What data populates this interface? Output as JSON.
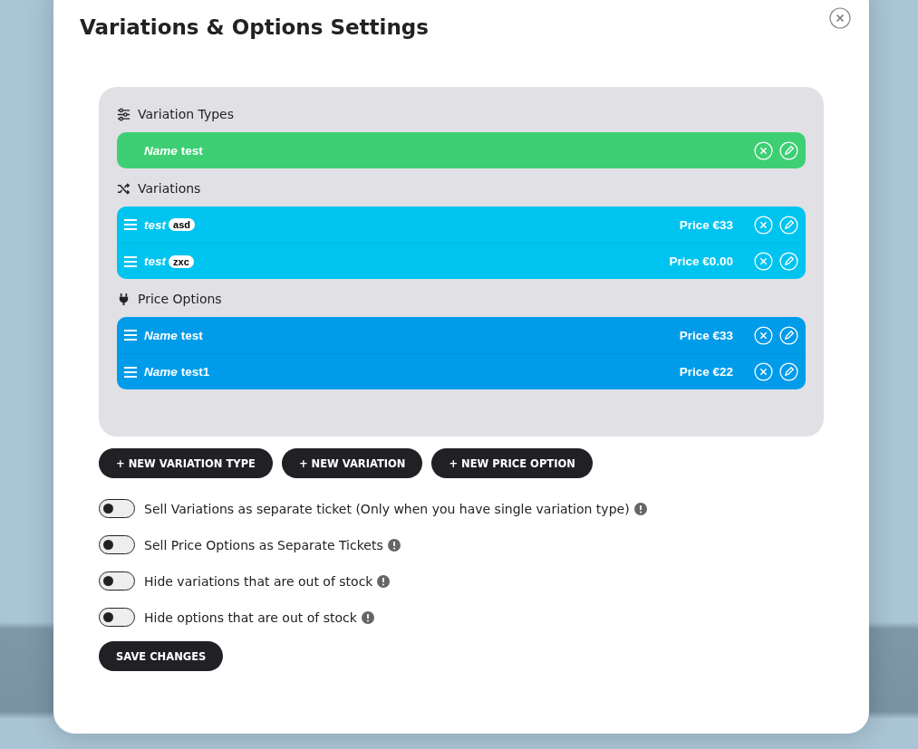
{
  "dialog": {
    "title": "Variations & Options Settings"
  },
  "sections": [
    {
      "kind": "types",
      "heading": "Variation Types",
      "color": "#3ecf74",
      "rows": [
        {
          "kind": "named",
          "label": "Name",
          "value": "test",
          "draggable": false
        }
      ]
    },
    {
      "kind": "variations",
      "heading": "Variations",
      "color": "#00c4f0",
      "rows": [
        {
          "kind": "tagged",
          "label": "test",
          "tag": "asd",
          "price": "Price €33",
          "draggable": true
        },
        {
          "kind": "tagged",
          "label": "test",
          "tag": "zxc",
          "price": "Price €0.00",
          "draggable": true
        }
      ]
    },
    {
      "kind": "options",
      "heading": "Price Options",
      "color": "#009cea",
      "rows": [
        {
          "kind": "named",
          "label": "Name",
          "value": "test",
          "price": "Price €33",
          "draggable": true
        },
        {
          "kind": "named",
          "label": "Name",
          "value": "test1",
          "price": "Price €22",
          "draggable": true
        }
      ]
    }
  ],
  "add_buttons": [
    "+ NEW VARIATION TYPE",
    "+ NEW VARIATION",
    "+ NEW PRICE OPTION"
  ],
  "toggles": [
    {
      "label": "Sell Variations as separate ticket (Only when you have single variation type)",
      "on": false
    },
    {
      "label": "Sell Price Options as Separate Tickets",
      "on": false
    },
    {
      "label": "Hide variations that are out of stock",
      "on": false
    },
    {
      "label": "Hide options that are out of stock",
      "on": false
    }
  ],
  "save_button": "SAVE CHANGES"
}
